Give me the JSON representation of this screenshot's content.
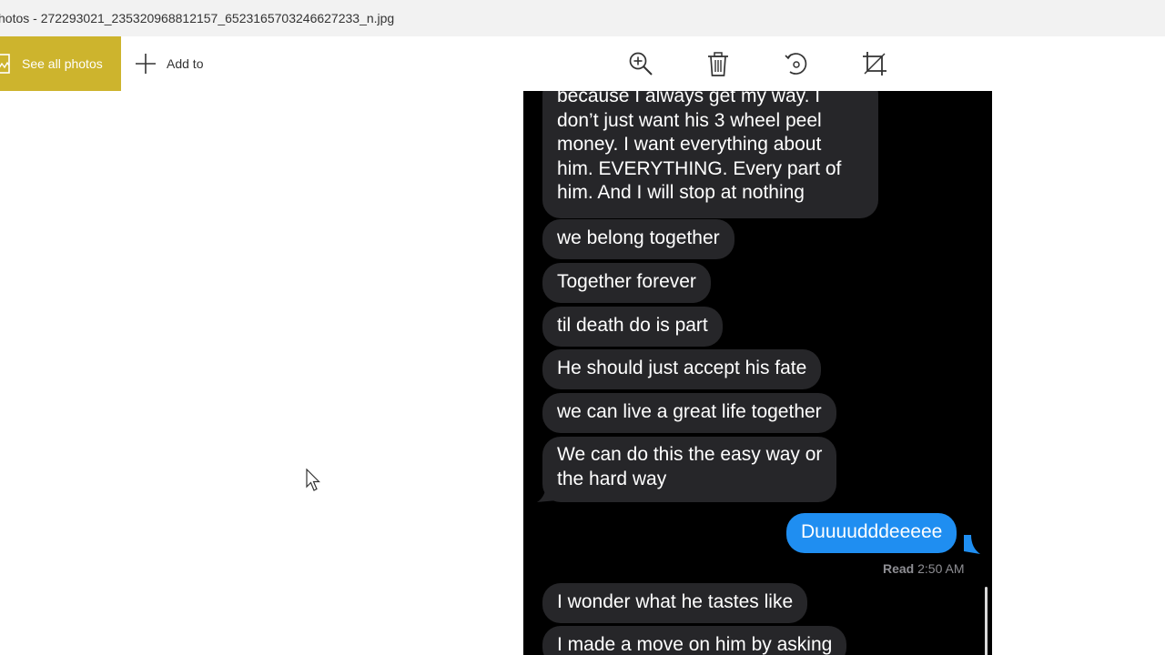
{
  "window": {
    "title": "hotos - 272293021_2353209688121​57_6523165703246627233_n.jpg"
  },
  "toolbar": {
    "see_all_label": "See all photos",
    "add_to_label": "Add to",
    "tools": [
      "zoom-icon",
      "delete-icon",
      "rotate-icon",
      "crop-icon"
    ]
  },
  "colors": {
    "accent": "#cdb42d",
    "received_bubble": "#262629",
    "sent_bubble": "#1f8ef1"
  },
  "conversation": {
    "messages": [
      {
        "text": "because I always get my way. I\ndon’t just want his 3 wheel peel\nmoney. I want everything about\nhim. EVERYTHING. Every part of\nhim. And I will stop at nothing",
        "from": "them"
      },
      {
        "text": "we belong together",
        "from": "them"
      },
      {
        "text": "Together forever",
        "from": "them"
      },
      {
        "text": "til death do is part",
        "from": "them"
      },
      {
        "text": "He should just accept his fate",
        "from": "them"
      },
      {
        "text": "we can live a great life together",
        "from": "them"
      },
      {
        "text": "We can do this the easy way or\nthe hard way",
        "from": "them"
      },
      {
        "text": "Duuuudddeeeee",
        "from": "me"
      },
      {
        "text": "I wonder what he tastes like",
        "from": "them"
      },
      {
        "text": "I made a move on him by asking",
        "from": "them"
      }
    ],
    "read_label": "Read",
    "read_time": "2:50 AM"
  }
}
